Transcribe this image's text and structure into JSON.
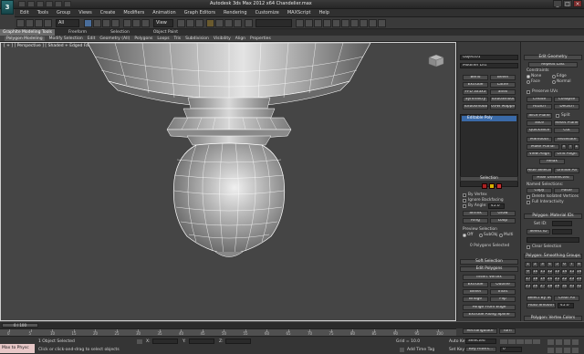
{
  "window": {
    "title": "Autodesk 3ds Max 2012 x64     Chandelier.max",
    "logo": "3",
    "minimize": "_",
    "maximize": "□",
    "close": "×"
  },
  "menus": [
    "Edit",
    "Tools",
    "Group",
    "Views",
    "Create",
    "Modifiers",
    "Animation",
    "Graph Editors",
    "Rendering",
    "Customize",
    "MAXScript",
    "Help"
  ],
  "toolbar": {
    "selection_filter": "All",
    "ref_coord": "View"
  },
  "ribbon_tabs": [
    "Graphite Modeling Tools",
    "Freeform",
    "Selection",
    "Object Paint"
  ],
  "ribbon_items": [
    "Polygon Modeling",
    "Modify Selection",
    "Edit",
    "Geometry (All)",
    "Polygons",
    "Loops",
    "Tris",
    "Subdivision",
    "Visibility",
    "Align",
    "Properties"
  ],
  "viewport": {
    "label": "[ + ] [ Perspective ] [ Shaded + Edged Faces ]"
  },
  "modify_panel": {
    "object_name": "Object01",
    "modifier_list": "Modifier List",
    "buttons": [
      "Bend",
      "Bevel",
      "Extrude",
      "Lathe",
      "FFD 3x3x3",
      "Shell",
      "Symmetry",
      "TurboSmooth",
      "Turbosmooth",
      "UVW Mapping Cl"
    ],
    "stack_item": "Editable Poly",
    "selection_title": "Selection",
    "by_vertex": "By Vertex",
    "ignore_backfacing": "Ignore Backfacing",
    "by_angle": "By Angle:",
    "angle_value": "45.0",
    "shrink": "Shrink",
    "grow": "Grow",
    "ring": "Ring",
    "loop": "Loop",
    "preview_selection": "Preview Selection",
    "preview_off": "Off",
    "preview_subobj": "SubObj",
    "preview_multi": "Multi",
    "status": "0 Polygons Selected",
    "soft_selection": "Soft Selection",
    "edit_polygons": "Edit Polygons",
    "insert_vertex": "Insert Vertex",
    "extrude": "Extrude",
    "outline": "Outline",
    "bevel": "Bevel",
    "inset": "Inset",
    "bridge": "Bridge",
    "flip": "Flip",
    "hinge": "Hinge From Edge",
    "extrude_spline": "Extrude Along Spline",
    "edit_triangulation": "Edit Triangulation",
    "retriangulate": "Retriangulate",
    "turn": "Turn"
  },
  "edit_geometry": {
    "title": "Edit Geometry",
    "repeat_last": "Repeat Last",
    "constraints": "Constraints",
    "none": "None",
    "edge": "Edge",
    "face": "Face",
    "normal": "Normal",
    "preserve_uvs": "Preserve UVs",
    "create": "Create",
    "collapse": "Collapse",
    "attach": "Attach",
    "detach": "Detach",
    "slice_plane": "Slice Plane",
    "split": "Split",
    "slice": "Slice",
    "reset_plane": "Reset Plane",
    "quickslice": "QuickSlice",
    "cut": "Cut",
    "msmooth": "MSmooth",
    "tessellate": "Tessellate",
    "make_planar": "Make Planar",
    "x": "X",
    "y": "Y",
    "z": "Z",
    "view_align": "View Align",
    "grid_align": "Grid Align",
    "relax": "Relax",
    "hide_selected": "Hide Selected",
    "unhide_all": "Unhide All",
    "hide_unselected": "Hide Unselected",
    "named_selections": "Named Selections:",
    "copy": "Copy",
    "paste": "Paste",
    "delete_isolated": "Delete Isolated Vertices",
    "full_interactivity": "Full Interactivity",
    "material_title": "Polygon: Material IDs",
    "set_id": "Set ID:",
    "select_id": "Select ID",
    "clear_selection": "Clear Selection",
    "smoothing_title": "Polygon: Smoothing Groups",
    "smoothing_numbers": [
      "1",
      "2",
      "3",
      "4",
      "5",
      "6",
      "7",
      "8",
      "9",
      "10",
      "11",
      "12",
      "13",
      "14",
      "15",
      "16",
      "17",
      "18",
      "19",
      "20",
      "21",
      "22",
      "23",
      "24",
      "25",
      "26",
      "27",
      "28",
      "29",
      "30",
      "31",
      "32"
    ],
    "select_by_sg": "Select By SG",
    "clear_all": "Clear All",
    "auto_smooth": "Auto Smooth",
    "auto_smooth_value": "45.0",
    "vertex_colors": "Polygon: Vertex Colors",
    "color": "Color:"
  },
  "timeline": {
    "slider": "0 / 100",
    "ticks": [
      "0",
      "5",
      "10",
      "15",
      "20",
      "25",
      "30",
      "35",
      "40",
      "45",
      "50",
      "55",
      "60",
      "65",
      "70",
      "75",
      "80",
      "85",
      "90",
      "95",
      "100"
    ]
  },
  "status": {
    "maxscript": "Max to Physc",
    "objects_selected": "1 Object Selected",
    "prompt": "Click or click-and-drag to select objects",
    "x_label": "X:",
    "y_label": "Y:",
    "z_label": "Z:",
    "grid": "Grid = 10.0",
    "auto_key": "Auto Key",
    "selected": "Selected",
    "set_key": "Set Key",
    "key_filters": "Key Filters...",
    "add_time_tag": "Add Time Tag",
    "frame": "0"
  }
}
